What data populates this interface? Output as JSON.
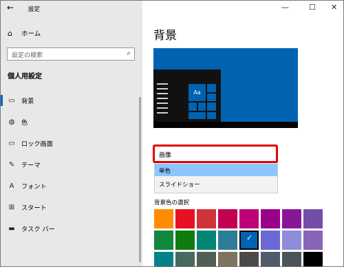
{
  "window": {
    "title": "設定",
    "back_icon": "←",
    "minimize": "—",
    "maximize": "☐",
    "close": "✕"
  },
  "sidebar": {
    "home_label": "ホーム",
    "search_placeholder": "設定の検索",
    "section_title": "個人用設定",
    "items": [
      {
        "label": "背景",
        "icon": "image-icon"
      },
      {
        "label": "色",
        "icon": "palette-icon"
      },
      {
        "label": "ロック画面",
        "icon": "lock-screen-icon"
      },
      {
        "label": "テーマ",
        "icon": "theme-icon"
      },
      {
        "label": "フォント",
        "icon": "font-icon"
      },
      {
        "label": "スタート",
        "icon": "start-icon"
      },
      {
        "label": "タスク バー",
        "icon": "taskbar-icon"
      }
    ]
  },
  "main": {
    "title": "背景",
    "preview_sample": "Aa",
    "dropdown": {
      "selected": "画像",
      "options": [
        "単色",
        "スライドショー"
      ]
    },
    "color_label": "背景色の選択",
    "colors": [
      "#ff8c00",
      "#e81123",
      "#d13438",
      "#c30052",
      "#bf0077",
      "#9a0089",
      "#881798",
      "#744da9",
      "#10893e",
      "#107c10",
      "#018574",
      "#2d7d9a",
      "#0063b1",
      "#6b69d6",
      "#8e8cd8",
      "#8764b8",
      "#038387",
      "#486860",
      "#525e54",
      "#7e735f",
      "#4c4a48",
      "#515c6b",
      "#4a5459",
      "#000000"
    ],
    "selected_color_index": 12
  },
  "colors": {
    "accent": "#0063b1",
    "highlight_border": "#e00000"
  }
}
